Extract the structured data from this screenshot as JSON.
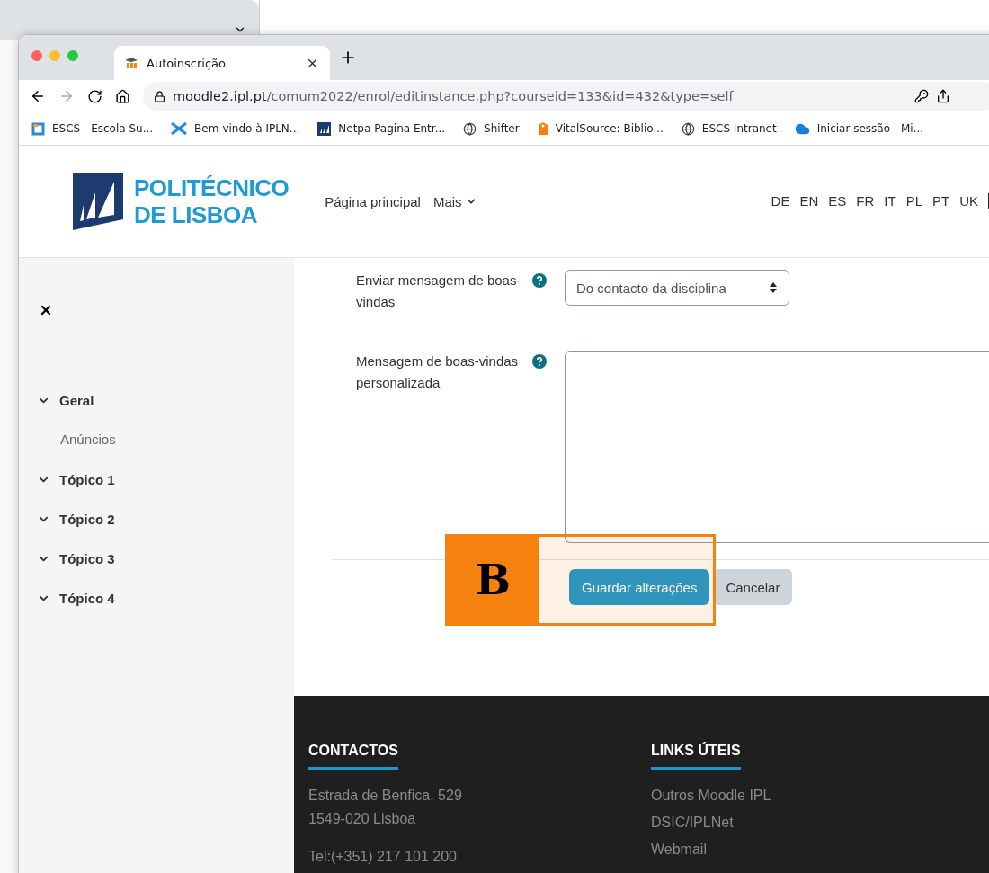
{
  "browser": {
    "tabs": [
      {
        "title": "Autoinscrição",
        "selected": true
      }
    ],
    "address": {
      "host": "moodle2.ipl.pt",
      "path": "/comum2022/enrol/editinstance.php?courseid=133&id=432&type=self"
    },
    "bookmarks": [
      {
        "label": "ESCS - Escola Su...",
        "kind": "escs"
      },
      {
        "label": "Bem-vindo à IPLN...",
        "kind": "cross"
      },
      {
        "label": "Netpa Pagina Entr...",
        "kind": "sail"
      },
      {
        "label": "Shifter",
        "kind": "globe"
      },
      {
        "label": "VitalSource: Biblio...",
        "kind": "tag"
      },
      {
        "label": "ESCS Intranet",
        "kind": "globe"
      },
      {
        "label": "Iniciar sessão - Mi...",
        "kind": "cloud"
      }
    ]
  },
  "header": {
    "logo": {
      "line1": "POLITÉCNICO",
      "line2": "DE LISBOA"
    },
    "nav": [
      {
        "label": "Página principal",
        "kind": "link"
      },
      {
        "label": "Mais",
        "kind": "menu"
      }
    ],
    "languages": [
      "DE",
      "EN",
      "ES",
      "FR",
      "IT",
      "PL",
      "PT",
      "UK"
    ]
  },
  "sidebar": {
    "items": [
      {
        "label": "Geral",
        "children": [
          {
            "label": "Anúncios"
          }
        ]
      },
      {
        "label": "Tópico 1"
      },
      {
        "label": "Tópico 2"
      },
      {
        "label": "Tópico 3"
      },
      {
        "label": "Tópico 4"
      }
    ]
  },
  "form": {
    "fields": [
      {
        "kind": "select",
        "label": "Enviar mensagem de boas-vindas",
        "value": "Do contacto da disciplina"
      },
      {
        "kind": "textarea",
        "label": "Mensagem de boas-vindas personalizada"
      }
    ],
    "buttons": [
      {
        "label": "Guardar alterações",
        "kind": "primary"
      },
      {
        "label": "Cancelar",
        "kind": "secondary"
      }
    ]
  },
  "callout": {
    "label": "B"
  },
  "footer": {
    "columns": [
      {
        "title": "CONTACTOS",
        "kind": "text",
        "lines": [
          "Estrada de Benfica, 529",
          "1549-020 Lisboa",
          "Tel:(+351) 217 101 200"
        ]
      },
      {
        "title": "LINKS ÚTEIS",
        "kind": "links",
        "lines": [
          "Outros Moodle IPL",
          "DSIC/IPLNet",
          "Webmail"
        ]
      }
    ]
  }
}
